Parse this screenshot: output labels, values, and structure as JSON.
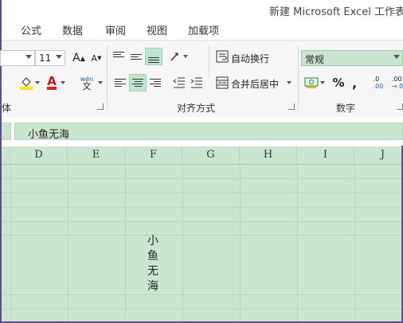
{
  "window": {
    "title": "新建 Microsoft Excel 工作表.x"
  },
  "tabs": [
    "公式",
    "数据",
    "审阅",
    "视图",
    "加载项"
  ],
  "ribbon": {
    "font_size": "11",
    "number_format": "常规",
    "wrap_text": "自动换行",
    "merge_center": "合并后居中",
    "percent": "%",
    "comma": ",",
    "wen": "wén",
    "wen_char": "文",
    "inc_dec_top": ".0",
    "inc_dec_bottom": ".00",
    "dec_dec_top": ".00",
    "dec_dec_bottom": "→.0",
    "grow_font": "A",
    "shrink_font": "A",
    "font_color_letter": "A",
    "group_font_tail": "体",
    "group_alignment": "对齐方式",
    "group_number": "数字"
  },
  "formula_bar": {
    "value": "小鱼无海"
  },
  "columns": [
    "D",
    "E",
    "F",
    "G",
    "H",
    "I",
    "J"
  ],
  "cell": {
    "address": "F",
    "text_vertical": [
      "小",
      "鱼",
      "无",
      "海"
    ]
  },
  "colors": {
    "selection_fill": "#bfe6cf",
    "sheet_bg": "#cbe6cf",
    "accent_red": "#e02424",
    "accent_yellow": "#ffe600"
  }
}
